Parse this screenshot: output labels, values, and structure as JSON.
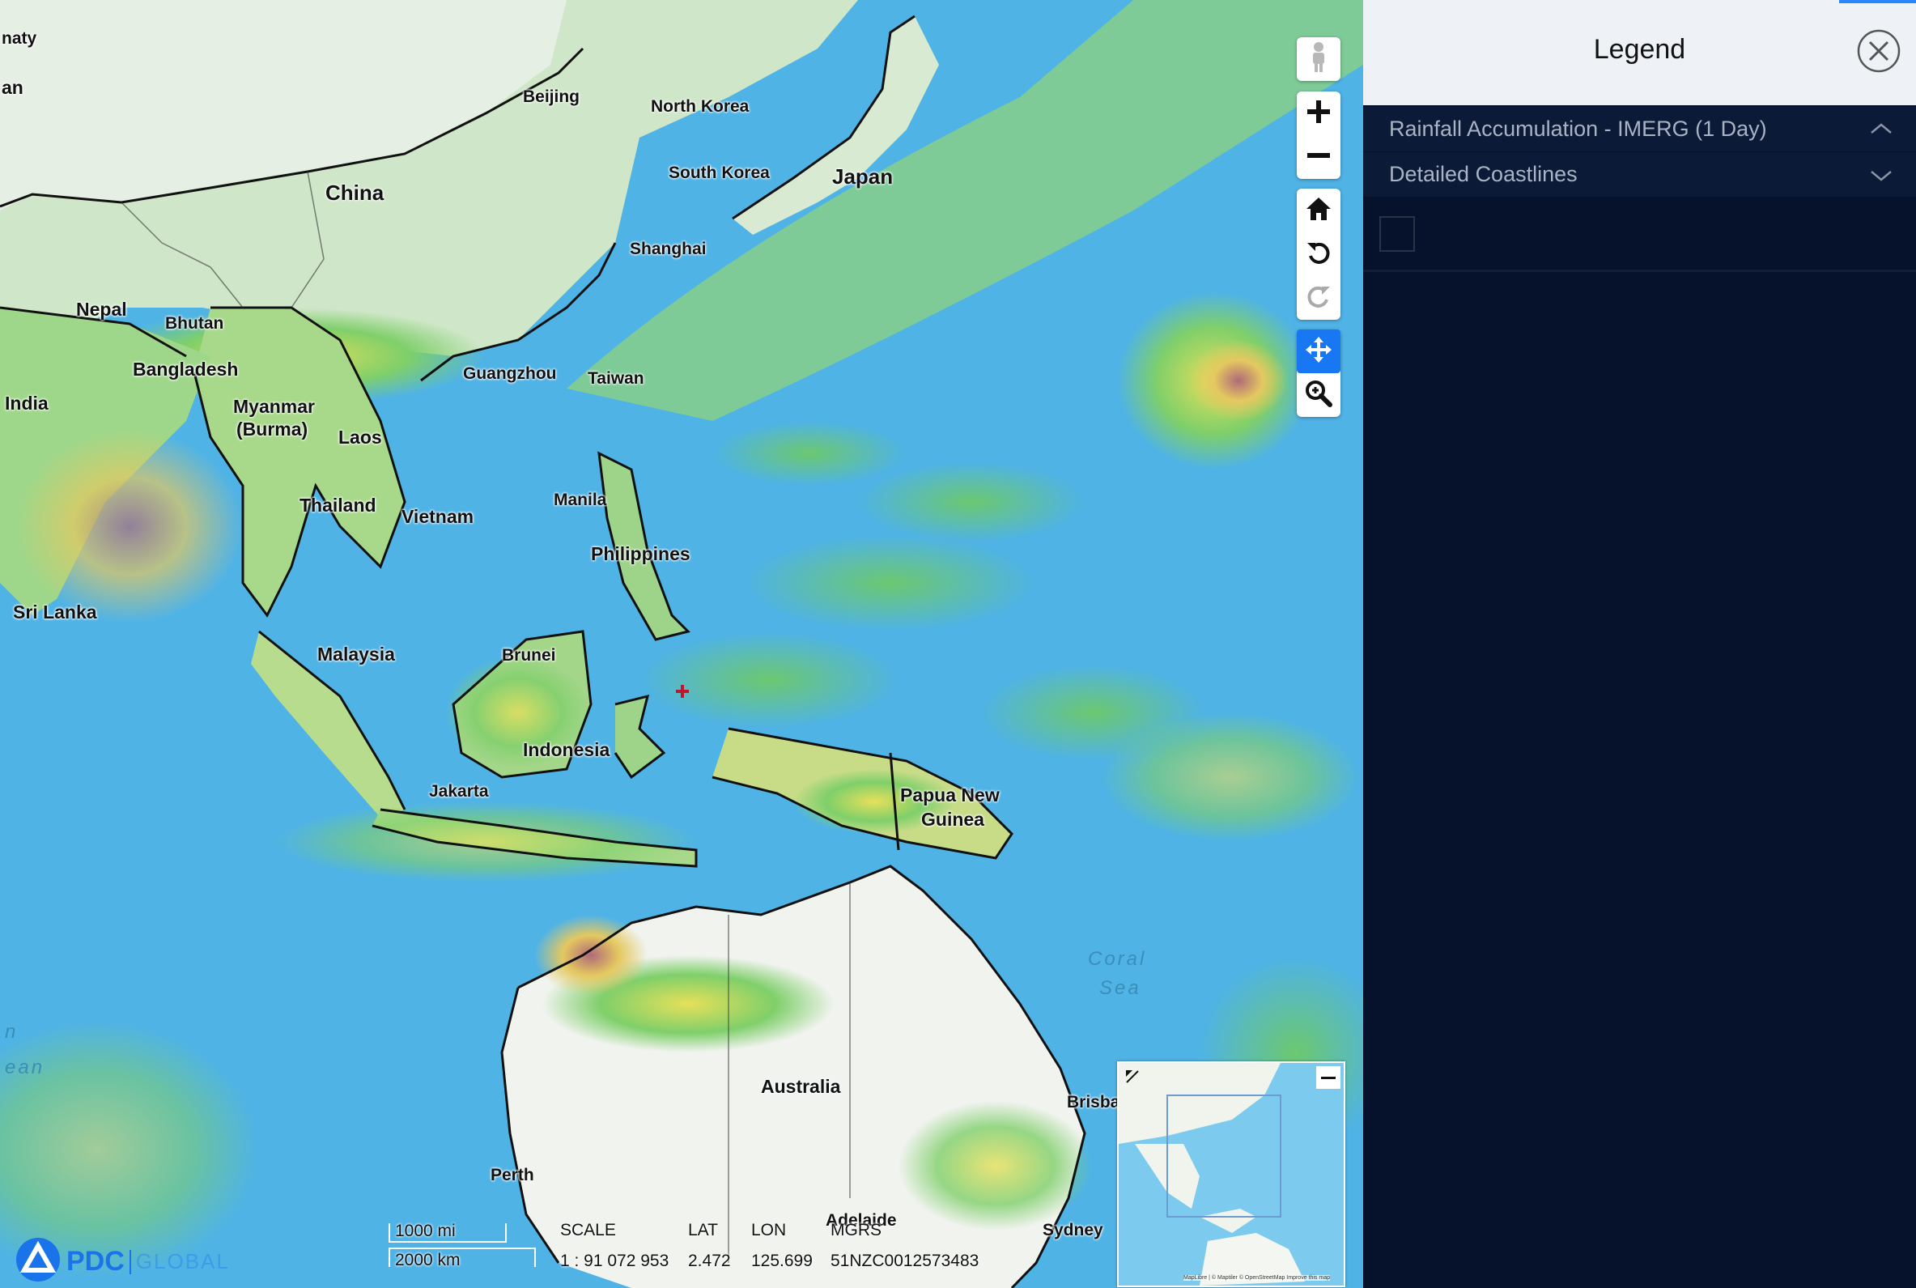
{
  "map": {
    "places": [
      {
        "id": "kazakhstan",
        "text": "naty",
        "size": "sm"
      },
      {
        "id": "kazakhstan2",
        "text": "an",
        "size": "mid"
      },
      {
        "id": "beijing",
        "text": "Beijing",
        "size": "sm"
      },
      {
        "id": "north-korea",
        "text": "North Korea",
        "size": "sm"
      },
      {
        "id": "south-korea",
        "text": "South Korea",
        "size": "sm"
      },
      {
        "id": "japan",
        "text": "Japan",
        "size": "big"
      },
      {
        "id": "china",
        "text": "China",
        "size": "big"
      },
      {
        "id": "shanghai",
        "text": "Shanghai",
        "size": "sm"
      },
      {
        "id": "nepal",
        "text": "Nepal",
        "size": "mid"
      },
      {
        "id": "bhutan",
        "text": "Bhutan",
        "size": "sm"
      },
      {
        "id": "bangladesh",
        "text": "Bangladesh",
        "size": "mid"
      },
      {
        "id": "guangzhou",
        "text": "Guangzhou",
        "size": "sm"
      },
      {
        "id": "taiwan",
        "text": "Taiwan",
        "size": "sm"
      },
      {
        "id": "india",
        "text": "India",
        "size": "mid"
      },
      {
        "id": "myanmar",
        "text": "Myanmar",
        "size": "mid"
      },
      {
        "id": "burma",
        "text": "(Burma)",
        "size": "mid"
      },
      {
        "id": "laos",
        "text": "Laos",
        "size": "mid"
      },
      {
        "id": "manila",
        "text": "Manila",
        "size": "sm"
      },
      {
        "id": "thailand",
        "text": "Thailand",
        "size": "mid"
      },
      {
        "id": "vietnam",
        "text": "Vietnam",
        "size": "mid"
      },
      {
        "id": "philippines",
        "text": "Philippines",
        "size": "mid"
      },
      {
        "id": "sri-lanka",
        "text": "Sri Lanka",
        "size": "mid"
      },
      {
        "id": "malaysia",
        "text": "Malaysia",
        "size": "mid"
      },
      {
        "id": "brunei",
        "text": "Brunei",
        "size": "sm"
      },
      {
        "id": "indonesia",
        "text": "Indonesia",
        "size": "mid"
      },
      {
        "id": "jakarta",
        "text": "Jakarta",
        "size": "sm"
      },
      {
        "id": "png1",
        "text": "Papua New",
        "size": "mid"
      },
      {
        "id": "png2",
        "text": "Guinea",
        "size": "mid"
      },
      {
        "id": "australia",
        "text": "Australia",
        "size": "mid"
      },
      {
        "id": "perth",
        "text": "Perth",
        "size": "sm"
      },
      {
        "id": "adelaide",
        "text": "Adelaide",
        "size": "sm"
      },
      {
        "id": "sydney",
        "text": "Sydney",
        "size": "sm"
      },
      {
        "id": "brisbane",
        "text": "Brisba",
        "size": "sm"
      }
    ],
    "seas": [
      {
        "id": "coral-sea-1",
        "text": "Coral"
      },
      {
        "id": "coral-sea-2",
        "text": "Sea"
      },
      {
        "id": "indian-ocean-1",
        "text": "n"
      },
      {
        "id": "indian-ocean-2",
        "text": "ean"
      }
    ],
    "toolbar": [
      {
        "name": "street-view-pegman",
        "icon": "pegman-icon"
      },
      {
        "name": "zoom-in-button",
        "icon": "plus-icon"
      },
      {
        "name": "zoom-out-button",
        "icon": "minus-icon"
      },
      {
        "name": "home-button",
        "icon": "home-icon"
      },
      {
        "name": "rotate-left-button",
        "icon": "rotate-ccw-icon"
      },
      {
        "name": "rotate-right-button",
        "icon": "rotate-cw-icon"
      },
      {
        "name": "pan-button",
        "icon": "move-arrows-icon"
      },
      {
        "name": "zoom-box-button",
        "icon": "zoom-magnifier-icon"
      }
    ],
    "scale": {
      "miles": "1000 mi",
      "km": "2000 km"
    },
    "readout": {
      "scale_label": "SCALE",
      "scale_value": "1 : 91 072 953",
      "lat_label": "LAT",
      "lat_value": "2.472",
      "lon_label": "LON",
      "lon_value": "125.699",
      "mgrs_label": "MGRS",
      "mgrs_value": "51NZC0012573483"
    },
    "logo": {
      "text": "PDC",
      "suffix": "GLOBAL"
    },
    "minimap": {
      "credits": "MapLibre | © Maptiler © OpenStreetMap Improve this map"
    }
  },
  "legend": {
    "title": "Legend",
    "layers": [
      {
        "label": "Rainfall Accumulation - IMERG (1 Day)",
        "expanded": true
      },
      {
        "label": "Detailed Coastlines",
        "expanded": false
      }
    ]
  },
  "colors": {
    "ocean": "#4fb3e6",
    "panel_bg": "#06122b",
    "panel_head": "#eef2f6",
    "active_tool": "#1877f2",
    "logo_blue": "#1a73e8"
  }
}
